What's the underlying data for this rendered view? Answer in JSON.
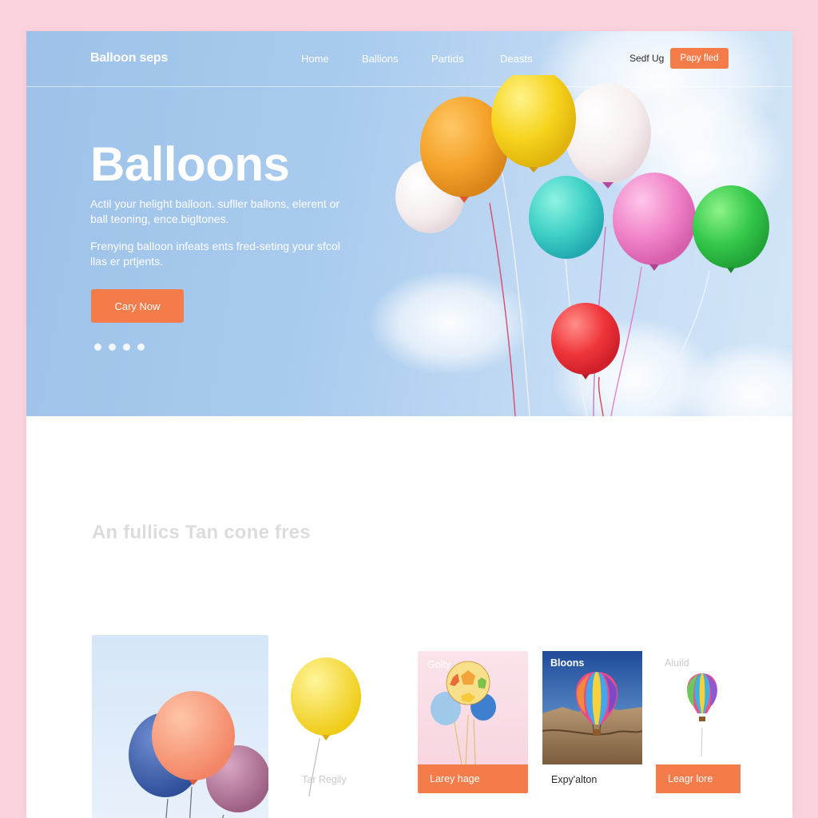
{
  "header": {
    "brand": "Balloon seps",
    "nav": [
      "Home",
      "Ballions",
      "Partids",
      "Deasts"
    ],
    "signin": "Sedf Ug",
    "cta": "Papy fled"
  },
  "hero": {
    "title": "Balloons",
    "paragraph1": "Actil your helight balloon. sufller ballons, elerent or ball teoning, ence.bigltones.",
    "paragraph2": "Frenying balloon infeats ents fred-seting your sfcol llas er prtjents.",
    "button": "Cary Now",
    "slides_total": 4
  },
  "section": {
    "title": "An fullics Tan cone fres"
  },
  "cards": [
    {
      "label": ""
    },
    {
      "label": "Tar Regily"
    },
    {
      "label": "Golty",
      "band": "Larey hage"
    },
    {
      "label": "Bloons",
      "caption": "Expy'alton"
    },
    {
      "label": "Aluild",
      "band": "Leagr lore"
    }
  ],
  "colors": {
    "accent": "#f47b4a",
    "page_background": "#fbd3dd",
    "sky": "#a9cbee"
  }
}
